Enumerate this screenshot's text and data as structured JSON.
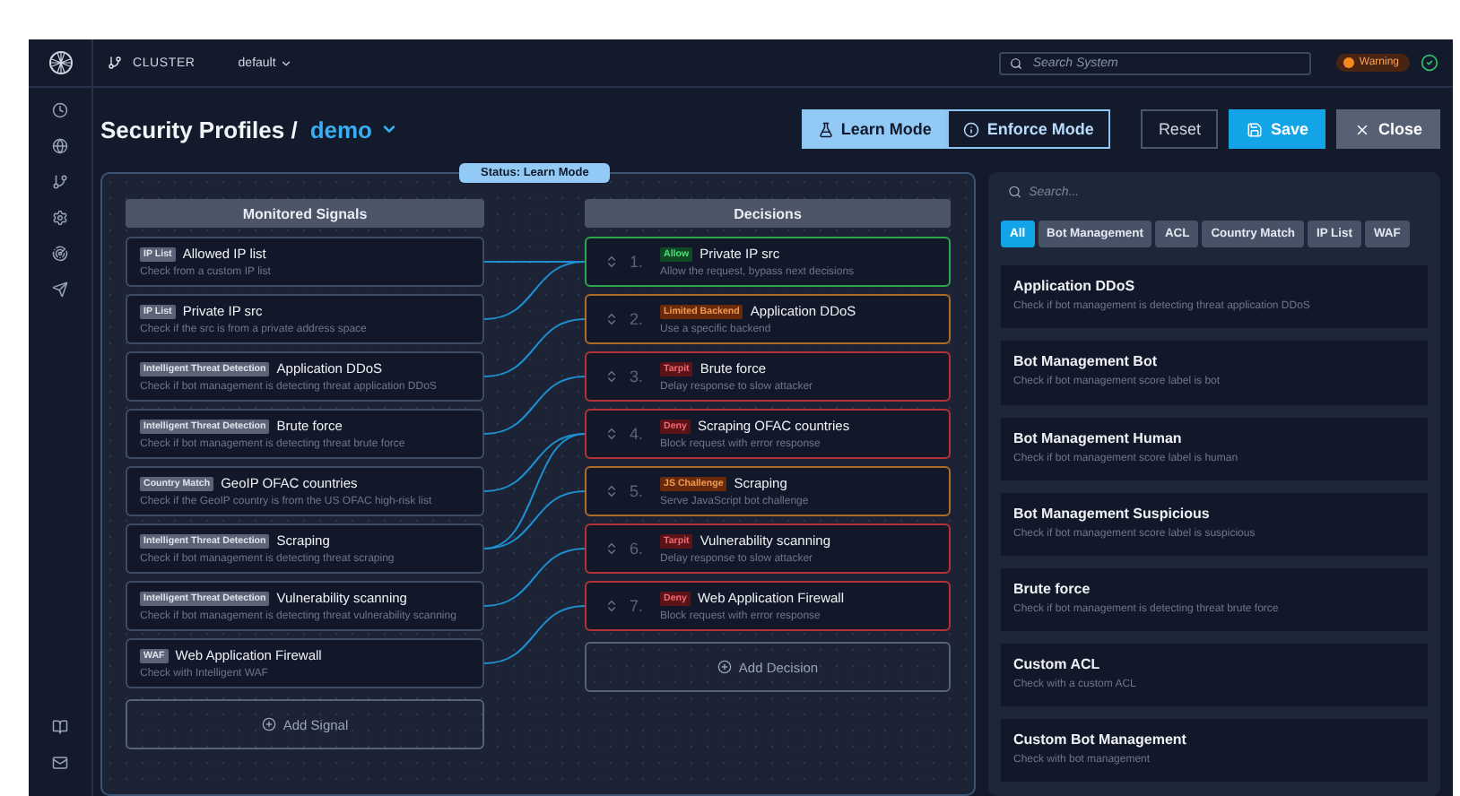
{
  "topbar": {
    "cluster_label": "CLUSTER",
    "cluster_value": "default",
    "search_placeholder": "Search System",
    "status_badge": "Warning"
  },
  "header": {
    "title": "Security Profiles /",
    "profile": "demo",
    "modes": [
      {
        "label": "Learn Mode",
        "selected": true
      },
      {
        "label": "Enforce Mode",
        "selected": false
      }
    ],
    "buttons": [
      {
        "label": "Reset",
        "kind": "reset"
      },
      {
        "label": "Save",
        "kind": "save"
      },
      {
        "label": "Close",
        "kind": "close"
      }
    ]
  },
  "status": "Status: Learn Mode",
  "signals": {
    "title": "Monitored Signals",
    "add": "Add Signal",
    "items": [
      {
        "tag": "IP List",
        "name": "Allowed IP list",
        "description": "Check from a custom IP list"
      },
      {
        "tag": "IP List",
        "name": "Private IP src",
        "description": "Check if the src is from a private address space"
      },
      {
        "tag": "Intelligent Threat Detection",
        "name": "Application DDoS",
        "description": "Check if bot management is detecting threat application DDoS"
      },
      {
        "tag": "Intelligent Threat Detection",
        "name": "Brute force",
        "description": "Check if bot management is detecting threat brute force"
      },
      {
        "tag": "Country Match",
        "name": "GeoIP OFAC countries",
        "description": "Check if the GeoIP country is from the US OFAC high-risk list"
      },
      {
        "tag": "Intelligent Threat Detection",
        "name": "Scraping",
        "description": "Check if bot management is detecting threat scraping"
      },
      {
        "tag": "Intelligent Threat Detection",
        "name": "Vulnerability scanning",
        "description": "Check if bot management is detecting threat vulnerability scanning"
      },
      {
        "tag": "WAF",
        "name": "Web Application Firewall",
        "description": "Check with Intelligent WAF"
      }
    ]
  },
  "decisions": {
    "title": "Decisions",
    "add": "Add Decision",
    "items": [
      {
        "number": "1.",
        "kind": "allow",
        "tag": "Allow",
        "name": "Private IP src",
        "description": "Allow the request, bypass next decisions"
      },
      {
        "number": "2.",
        "kind": "warn",
        "tag": "Limited Backend",
        "name": "Application DDoS",
        "description": "Use a specific backend"
      },
      {
        "number": "3.",
        "kind": "block",
        "tag": "Tarpit",
        "name": "Brute force",
        "description": "Delay response to slow attacker"
      },
      {
        "number": "4.",
        "kind": "block",
        "tag": "Deny",
        "name": "Scraping OFAC countries",
        "description": "Block request with error response"
      },
      {
        "number": "5.",
        "kind": "warn",
        "tag": "JS Challenge",
        "name": "Scraping",
        "description": "Serve JavaScript bot challenge"
      },
      {
        "number": "6.",
        "kind": "block",
        "tag": "Tarpit",
        "name": "Vulnerability scanning",
        "description": "Delay response to slow attacker"
      },
      {
        "number": "7.",
        "kind": "block",
        "tag": "Deny",
        "name": "Web Application Firewall",
        "description": "Block request with error response"
      }
    ]
  },
  "library": {
    "search_placeholder": "Search...",
    "filters": [
      {
        "label": "All",
        "selected": true
      },
      {
        "label": "Bot Management",
        "selected": false
      },
      {
        "label": "ACL",
        "selected": false
      },
      {
        "label": "Country Match",
        "selected": false
      },
      {
        "label": "IP List",
        "selected": false
      },
      {
        "label": "WAF",
        "selected": false
      }
    ],
    "items": [
      {
        "name": "Application DDoS",
        "description": "Check if bot management is detecting threat application DDoS"
      },
      {
        "name": "Bot Management Bot",
        "description": "Check if bot management score label is bot"
      },
      {
        "name": "Bot Management Human",
        "description": "Check if bot management score label is human"
      },
      {
        "name": "Bot Management Suspicious",
        "description": "Check if bot management score label is suspicious"
      },
      {
        "name": "Brute force",
        "description": "Check if bot management is detecting threat brute force"
      },
      {
        "name": "Custom ACL",
        "description": "Check with a custom ACL"
      },
      {
        "name": "Custom Bot Management",
        "description": "Check with bot management"
      }
    ]
  }
}
